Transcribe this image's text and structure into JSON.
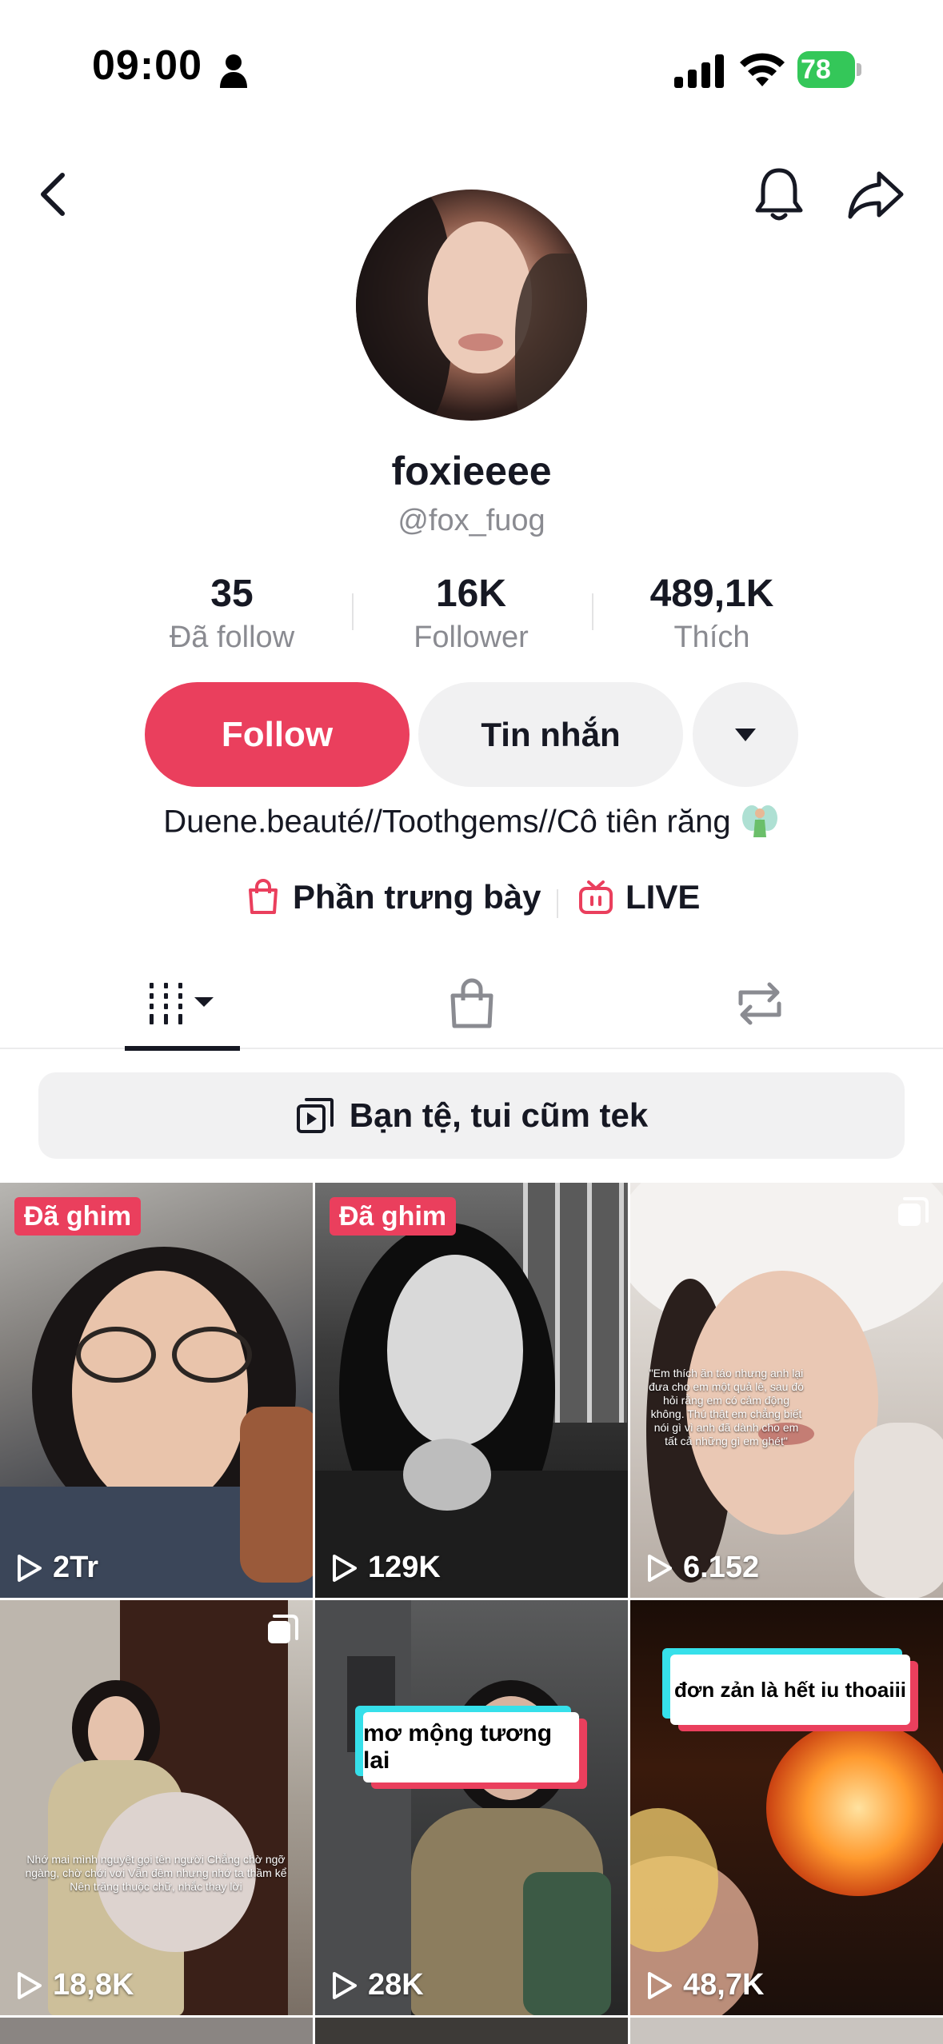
{
  "status_bar": {
    "time": "09:00",
    "battery": "78"
  },
  "profile": {
    "display_name": "foxieeee",
    "handle": "@fox_fuog",
    "stats": [
      {
        "value": "35",
        "label": "Đã follow"
      },
      {
        "value": "16K",
        "label": "Follower"
      },
      {
        "value": "489,1K",
        "label": "Thích"
      }
    ],
    "follow_label": "Follow",
    "message_label": "Tin nhắn",
    "bio": "Duene.beauté//Toothgems//Cô tiên răng",
    "links": {
      "showcase": "Phần trưng bày",
      "live": "LIVE"
    }
  },
  "playlist_label": "Bạn tệ, tui cũm tek",
  "videos": [
    {
      "pinned": "Đã ghim",
      "views": "2Tr"
    },
    {
      "pinned": "Đã ghim",
      "views": "129K"
    },
    {
      "views": "6.152",
      "overlay": "\"Em thích ăn táo nhưng anh lại đưa cho em một quả lê, sau đó hỏi rằng em có cảm động không. Thú thật em chẳng biết nói gì vì anh đã dành cho em tất cả những gì em ghét\""
    },
    {
      "views": "18,8K",
      "overlay": "Nhớ mai mình nguyệt gọi tên người Chẳng chờ ngỡ ngàng, chờ chới vơi Vẫn đêm nhưng nhớ ta thầm kể Nên trăng thuộc chữ, nhắc thay lời"
    },
    {
      "views": "28K",
      "caption": "mơ mộng tương lai"
    },
    {
      "views": "48,7K",
      "caption": "đơn zản là hết iu thoaiii"
    }
  ],
  "colors": {
    "accent": "#ea3f5d",
    "battery": "#34c759",
    "muted": "#8a8b91"
  }
}
